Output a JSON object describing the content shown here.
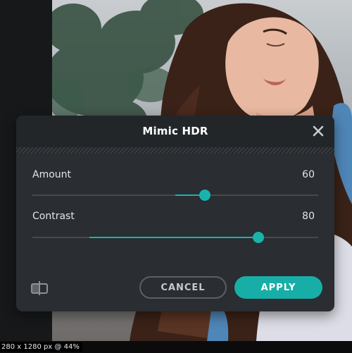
{
  "status_bar": {
    "text": "280 x 1280 px @ 44%"
  },
  "dialog": {
    "title": "Mimic HDR",
    "close_icon": "close-icon",
    "compare_icon": "compare-split-icon",
    "accent_color": "#19b3ad",
    "sliders": [
      {
        "label": "Amount",
        "value": "60",
        "position": 0.6
      },
      {
        "label": "Contrast",
        "value": "80",
        "position": 0.8
      }
    ],
    "buttons": {
      "cancel": "CANCEL",
      "apply": "APPLY"
    }
  }
}
